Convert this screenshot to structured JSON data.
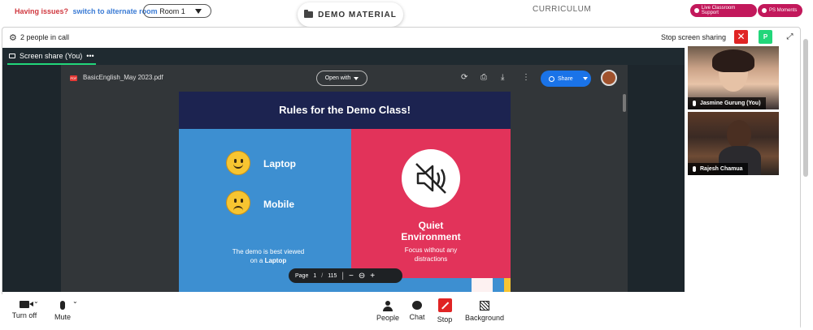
{
  "topbar": {
    "issues_text": "Having issues?",
    "alternate_link": "switch to alternate room",
    "room_label": "Room 1",
    "demo_material": "DEMO MATERIAL",
    "curriculum": "CURRICULUM",
    "live_support": "Live Classroom Support",
    "ps_moments": "PS Moments"
  },
  "call": {
    "people_count": "2 people in call",
    "stop_sharing": "Stop screen sharing",
    "p_badge": "P"
  },
  "share": {
    "tab_label": "Screen share (You)",
    "tab_menu": "•••"
  },
  "pdf": {
    "filename": "BasicEnglish_May 2023.pdf",
    "open_with": "Open with",
    "share": "Share",
    "page_label": "Page",
    "current_page": "1",
    "page_sep": "/",
    "total_pages": "115"
  },
  "slide": {
    "title": "Rules for the Demo Class!",
    "laptop": "Laptop",
    "mobile": "Mobile",
    "note_line1": "The demo is best viewed",
    "note_line2_prefix": "on a",
    "note_line2_bold": "Laptop",
    "quiet_title_line1": "Quiet",
    "quiet_title_line2": "Environment",
    "quiet_sub_line1": "Focus without any",
    "quiet_sub_line2": "distractions"
  },
  "participants": [
    {
      "name": "Jasmine Gurung (You)"
    },
    {
      "name": "Rajesh Chamua"
    }
  ],
  "controls": {
    "turn_off": "Turn off",
    "mute": "Mute",
    "people": "People",
    "chat": "Chat",
    "stop": "Stop",
    "background": "Background"
  },
  "colors": {
    "accent_red": "#e02424",
    "accent_green": "#22d67a",
    "brand_pink": "#c2185b",
    "slide_blue": "#3d8fd1",
    "slide_red": "#e2335a",
    "slide_navy": "#1c2350"
  }
}
